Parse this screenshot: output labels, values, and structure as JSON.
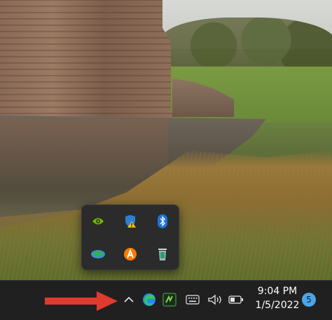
{
  "system_tray": {
    "clock_time": "9:04 PM",
    "clock_date": "1/5/2022",
    "notification_count": "5"
  },
  "icons": {
    "flyout": [
      "nvidia-icon",
      "windows-security-warning-icon",
      "bluetooth-icon",
      "download-manager-icon",
      "avast-icon",
      "recycle-bin-icon"
    ],
    "taskbar": [
      "chevron-up-icon",
      "edge-icon",
      "camtasia-icon",
      "keyboard-icon",
      "volume-icon",
      "battery-icon"
    ]
  },
  "colors": {
    "taskbar": "#202020",
    "flyout": "#2b2b2b",
    "badge": "#4aa6e8",
    "annotation_arrow": "#e03a2f"
  }
}
